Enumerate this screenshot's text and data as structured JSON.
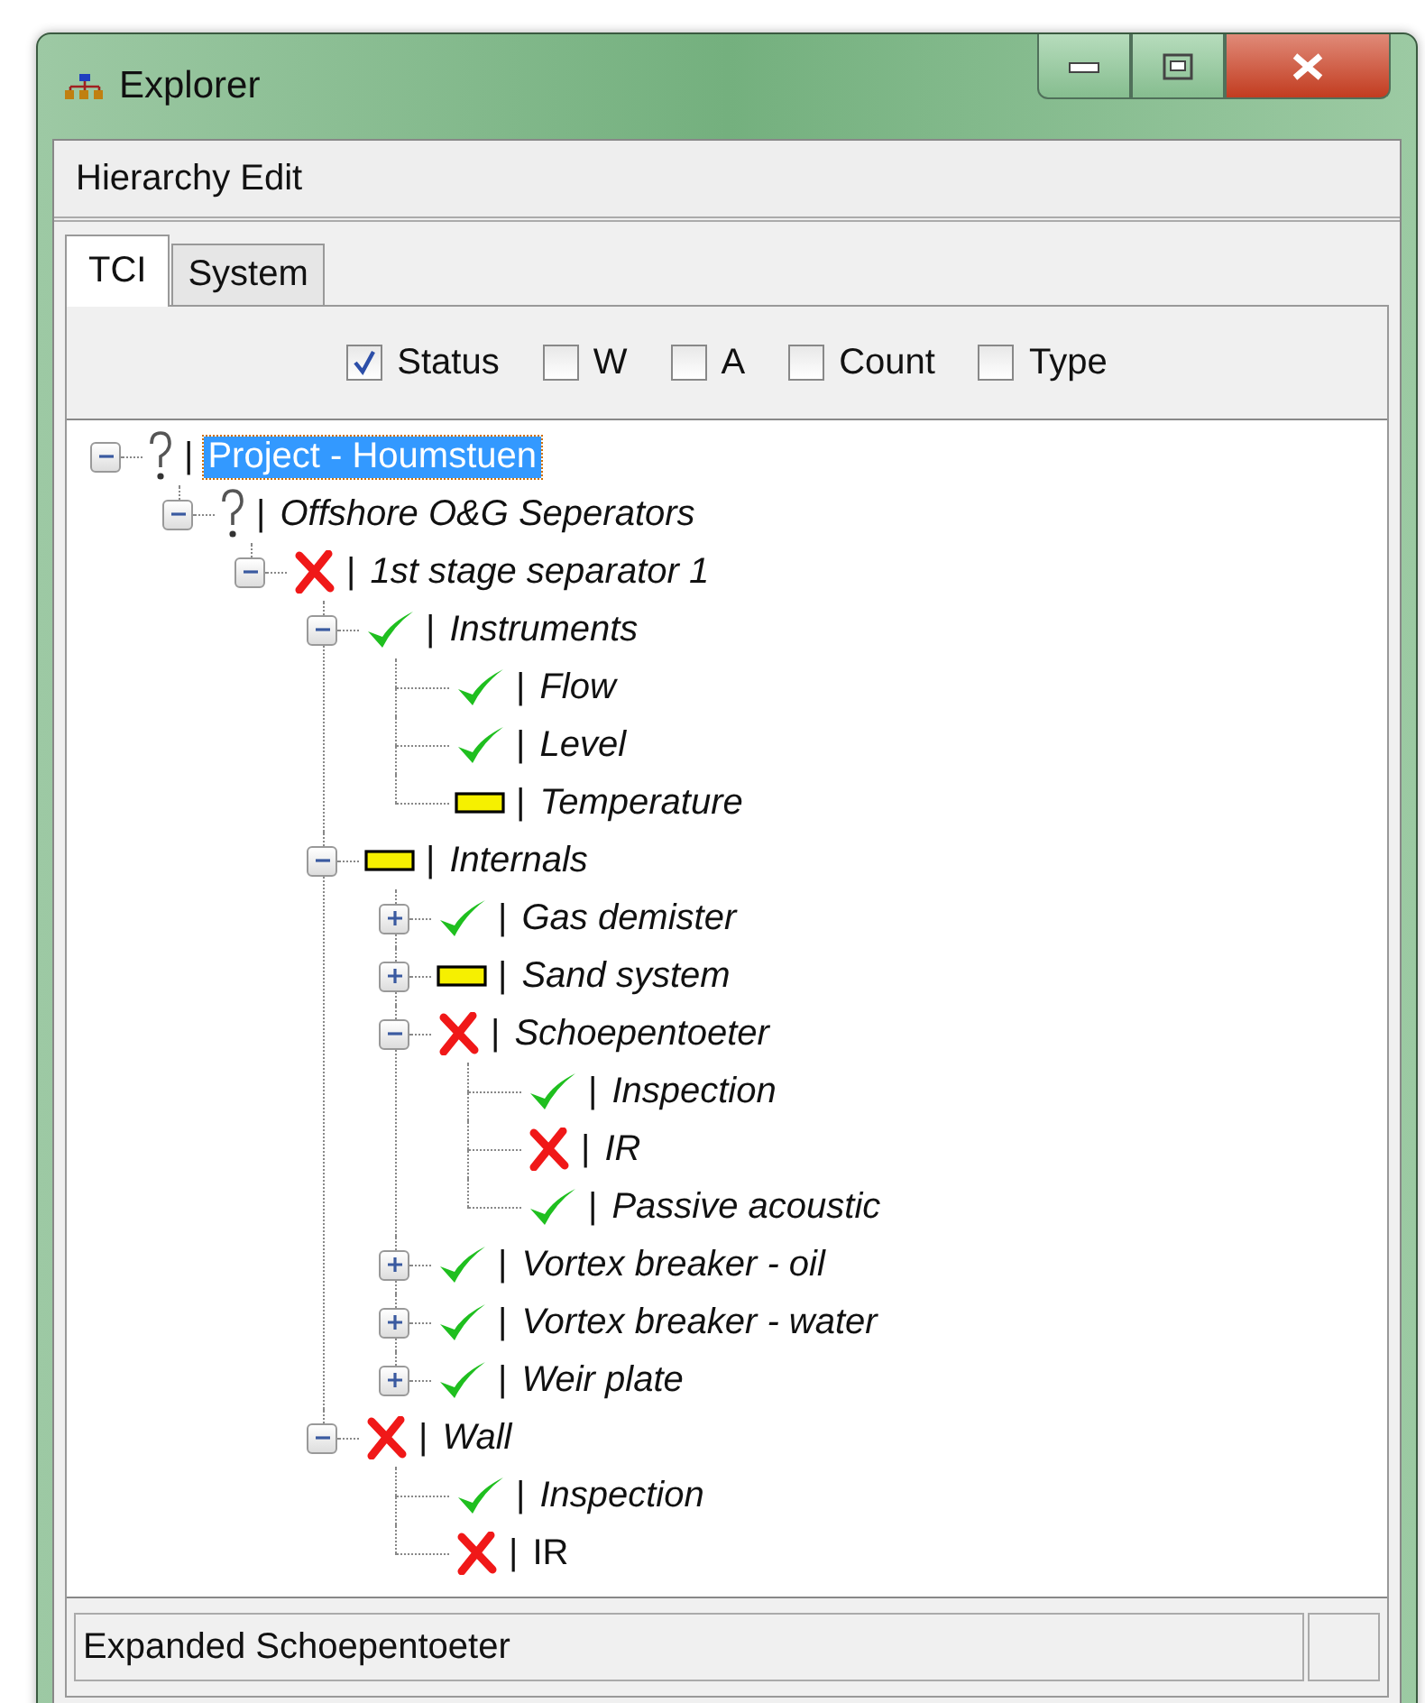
{
  "window": {
    "title": "Explorer"
  },
  "menu": {
    "label": "Hierarchy Edit"
  },
  "tabs": [
    {
      "label": "TCI",
      "selected": true
    },
    {
      "label": "System",
      "selected": false
    }
  ],
  "options": [
    {
      "label": "Status",
      "checked": true
    },
    {
      "label": "W",
      "checked": false
    },
    {
      "label": "A",
      "checked": false
    },
    {
      "label": "Count",
      "checked": false
    },
    {
      "label": "Type",
      "checked": false
    }
  ],
  "tree": [
    {
      "kind": "unknown",
      "separator": "|",
      "label": "Project - Houmstuen",
      "italic": false,
      "selected": true,
      "expanded": true,
      "children": [
        {
          "kind": "unknown",
          "separator": "|",
          "label": "Offshore O&G Seperators",
          "italic": true,
          "selected": false,
          "expanded": true,
          "children": [
            {
              "kind": "fail",
              "separator": "|",
              "label": "1st stage separator 1",
              "italic": true,
              "selected": false,
              "expanded": true,
              "children": [
                {
                  "kind": "pass",
                  "separator": "|",
                  "label": "Instruments",
                  "italic": true,
                  "selected": false,
                  "expanded": true,
                  "children": [
                    {
                      "kind": "pass",
                      "separator": "|",
                      "label": "Flow",
                      "italic": true,
                      "selected": false
                    },
                    {
                      "kind": "pass",
                      "separator": "|",
                      "label": "Level",
                      "italic": true,
                      "selected": false
                    },
                    {
                      "kind": "partial",
                      "separator": "|",
                      "label": "Temperature",
                      "italic": true,
                      "selected": false
                    }
                  ]
                },
                {
                  "kind": "partial",
                  "separator": "|",
                  "label": "Internals",
                  "italic": true,
                  "selected": false,
                  "expanded": true,
                  "children": [
                    {
                      "kind": "pass",
                      "separator": "|",
                      "label": "Gas demister",
                      "italic": true,
                      "selected": false,
                      "expanded": false
                    },
                    {
                      "kind": "partial",
                      "separator": "|",
                      "label": "Sand system",
                      "italic": true,
                      "selected": false,
                      "expanded": false
                    },
                    {
                      "kind": "fail",
                      "separator": "|",
                      "label": "Schoepentoeter",
                      "italic": true,
                      "selected": false,
                      "expanded": true,
                      "children": [
                        {
                          "kind": "pass",
                          "separator": "|",
                          "label": "Inspection",
                          "italic": true,
                          "selected": false
                        },
                        {
                          "kind": "fail",
                          "separator": "|",
                          "label": "IR",
                          "italic": true,
                          "selected": false
                        },
                        {
                          "kind": "pass",
                          "separator": "|",
                          "label": "Passive acoustic",
                          "italic": true,
                          "selected": false
                        }
                      ]
                    },
                    {
                      "kind": "pass",
                      "separator": "|",
                      "label": "Vortex breaker - oil",
                      "italic": true,
                      "selected": false,
                      "expanded": false
                    },
                    {
                      "kind": "pass",
                      "separator": "|",
                      "label": "Vortex breaker - water",
                      "italic": true,
                      "selected": false,
                      "expanded": false
                    },
                    {
                      "kind": "pass",
                      "separator": "|",
                      "label": "Weir plate",
                      "italic": true,
                      "selected": false,
                      "expanded": false
                    }
                  ]
                },
                {
                  "kind": "fail",
                  "separator": "|",
                  "label": "Wall",
                  "italic": true,
                  "selected": false,
                  "expanded": true,
                  "children": [
                    {
                      "kind": "pass",
                      "separator": "|",
                      "label": "Inspection",
                      "italic": true,
                      "selected": false
                    },
                    {
                      "kind": "fail",
                      "separator": "|",
                      "label": "IR",
                      "italic": false,
                      "selected": false
                    }
                  ]
                }
              ]
            }
          ]
        }
      ]
    }
  ],
  "status_bar": {
    "text": "Expanded Schoepentoeter"
  }
}
